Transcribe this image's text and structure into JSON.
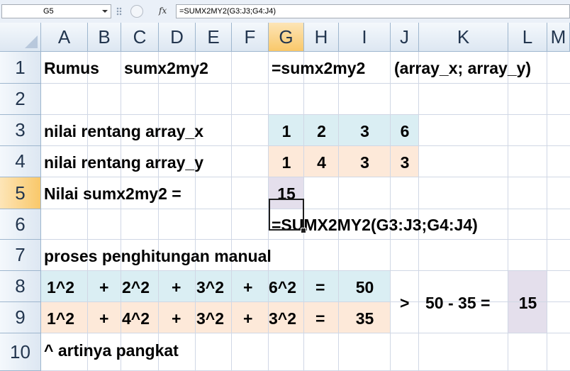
{
  "formula_bar": {
    "name_box": "G5",
    "fx_label": "fx",
    "formula": "=SUMX2MY2(G3:J3;G4:J4)"
  },
  "columns": [
    "A",
    "B",
    "C",
    "D",
    "E",
    "F",
    "G",
    "H",
    "I",
    "J",
    "K",
    "L",
    "M"
  ],
  "rows": [
    "1",
    "2",
    "3",
    "4",
    "5",
    "6",
    "7",
    "8",
    "9",
    "10"
  ],
  "selected_cell": "G5",
  "colors": {
    "array_x_fill": "#daeef3",
    "array_y_fill": "#fde9d9",
    "result_fill": "#e4dfec",
    "header_selected": "#f9c86a",
    "gridline": "#d0d7e5"
  },
  "cells": {
    "A1": "Rumus",
    "C1": "sumx2my2",
    "G1": "=sumx2my2",
    "J1": "(array_x; array_y)",
    "A3": "nilai rentang array_x",
    "A4": "nilai rentang array_y",
    "A5": "Nilai sumx2my2 =",
    "A7": "proses penghitungan manual",
    "A10": "^ artinya pangkat",
    "G6": "=SUMX2MY2(G3:J3;G4:J4)",
    "G3": "1",
    "H3": "2",
    "I3": "3",
    "J3": "6",
    "G4": "1",
    "H4": "4",
    "I4": "3",
    "J4": "3",
    "G5": "15",
    "row8": [
      "1^2",
      "+",
      "2^2",
      "+",
      "3^2",
      "+",
      "6^2",
      "=",
      "50"
    ],
    "row9": [
      "1^2",
      "+",
      "4^2",
      "+",
      "3^2",
      "+",
      "3^2",
      "=",
      "35"
    ],
    "J8": ">",
    "K8": "50 - 35 =",
    "L8": "15"
  }
}
